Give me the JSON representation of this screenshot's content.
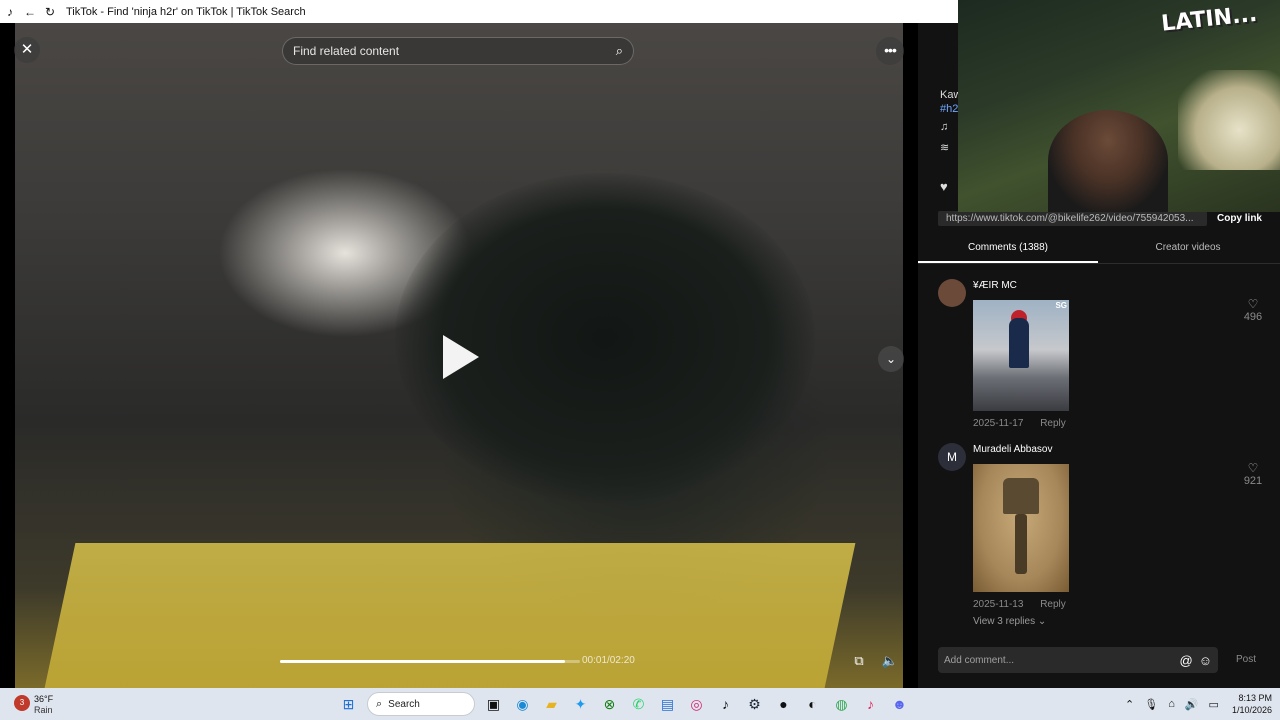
{
  "window": {
    "title": "TikTok - Find 'ninja h2r' on TikTok | TikTok Search"
  },
  "video": {
    "search_placeholder": "Find related content",
    "timecode": "00:01/02:20",
    "progress_fraction": 0.95
  },
  "side_panel": {
    "partial_caption": "Kaw",
    "partial_hashtag": "#h2",
    "share_url": "https://www.tiktok.com/@bikelife262/video/755942053...",
    "copy_link_label": "Copy link",
    "tabs": [
      {
        "label": "Comments (1388)",
        "active": true
      },
      {
        "label": "Creator videos",
        "active": false
      }
    ],
    "comments": [
      {
        "username": "¥ÆIR MC",
        "image_label": "SG",
        "date": "2025-11-17",
        "reply_label": "Reply",
        "likes": "496"
      },
      {
        "avatar_letter": "M",
        "username": "Muradeli Abbasov",
        "date": "2025-11-13",
        "reply_label": "Reply",
        "likes": "921",
        "view_replies": "View 3 replies ⌄"
      }
    ],
    "comment_input_placeholder": "Add comment...",
    "post_label": "Post"
  },
  "webcam": {
    "graffiti_text": "LATIN..."
  },
  "taskbar": {
    "weather": {
      "badge": "3",
      "temp": "36°F",
      "condition": "Rain"
    },
    "search_label": "Search",
    "time": "8:13 PM",
    "date": "1/10/2026"
  }
}
